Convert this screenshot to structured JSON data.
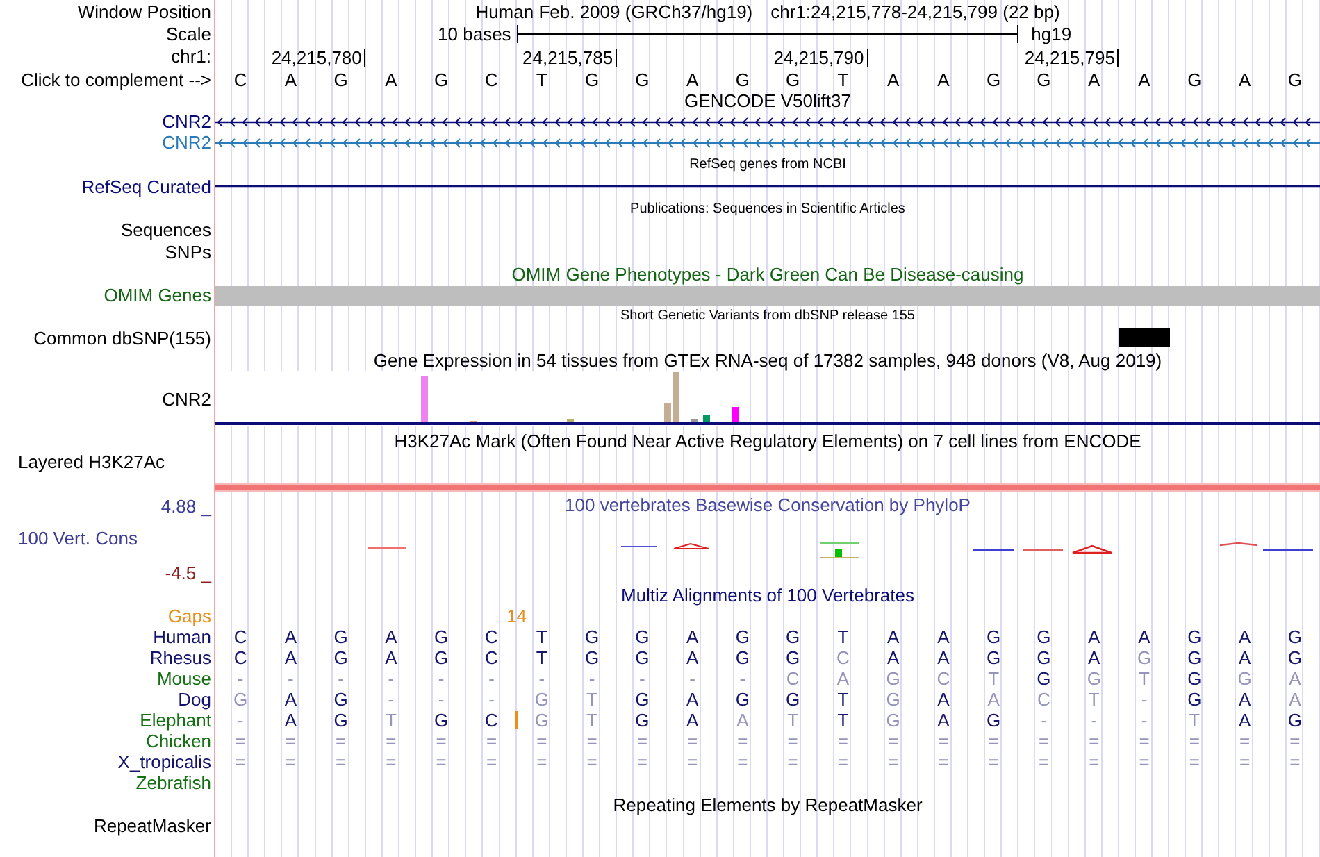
{
  "position": {
    "label": "Window Position",
    "assembly": "Human Feb. 2009 (GRCh37/hg19)",
    "range": "chr1:24,215,778-24,215,799 (22 bp)"
  },
  "scale": {
    "label": "Scale",
    "span": "10 bases",
    "assembly": "hg19"
  },
  "ruler": {
    "label": "chr1:",
    "ticks": [
      "24,215,780",
      "24,215,785",
      "24,215,790",
      "24,215,795"
    ]
  },
  "sequence": {
    "label": "Click to complement -->",
    "bases": [
      "C",
      "A",
      "G",
      "A",
      "G",
      "C",
      "T",
      "G",
      "G",
      "A",
      "G",
      "G",
      "T",
      "A",
      "A",
      "G",
      "G",
      "A",
      "A",
      "G",
      "A",
      "G"
    ]
  },
  "tracks": [
    {
      "kind": "gene_models",
      "title": {
        "text": "GENCODE V50lift37",
        "color": "#000000"
      },
      "rows": [
        {
          "label": "CNR2",
          "color": "#0c0c78"
        },
        {
          "label": "CNR2",
          "color": "#2b7bba"
        }
      ]
    },
    {
      "kind": "gene_line",
      "title": {
        "text": "RefSeq genes from NCBI",
        "color": "#000000"
      },
      "rows": [
        {
          "label": "RefSeq Curated",
          "color": "#0c0c78"
        }
      ]
    },
    {
      "kind": "empty_rows",
      "title": {
        "text": "Publications: Sequences in Scientific Articles",
        "color": "#000000"
      },
      "rows": [
        {
          "label": "Sequences",
          "color": "#000000"
        },
        {
          "label": "SNPs",
          "color": "#000000"
        }
      ]
    },
    {
      "kind": "bar",
      "title": {
        "text": "OMIM Gene Phenotypes - Dark Green Can Be Disease-causing",
        "color": "#146414"
      },
      "rows": [
        {
          "label": "OMIM Genes",
          "color": "#146414"
        }
      ]
    },
    {
      "kind": "variants",
      "title": {
        "text": "Short Genetic Variants from dbSNP release 155",
        "color": "#000000"
      },
      "rows": [
        {
          "label": "Common dbSNP(155)",
          "color": "#000000"
        }
      ]
    },
    {
      "kind": "expression",
      "title": {
        "text": "Gene Expression in 54 tissues from GTEx RNA-seq of 17382 samples, 948 donors (V8, Aug 2019)",
        "color": "#000000"
      },
      "rows": [
        {
          "label": "CNR2",
          "color": "#000000"
        }
      ]
    },
    {
      "kind": "signal",
      "title": {
        "text": "H3K27Ac Mark (Often Found Near Active Regulatory Elements) on 7 cell lines from ENCODE",
        "color": "#000000"
      },
      "rows": [
        {
          "label": "Layered H3K27Ac",
          "color": "#000000"
        }
      ]
    },
    {
      "kind": "conservation",
      "title": {
        "text": "100 vertebrates Basewise Conservation by PhyloP",
        "color": "#46469c"
      },
      "axis": {
        "max": {
          "text": "4.88 _",
          "color": "#3c3c96"
        },
        "min": {
          "text": "-4.5 _",
          "color": "#8b1e1e"
        }
      },
      "rows": [
        {
          "label": "100 Vert. Cons",
          "color": "#3c3c96"
        }
      ]
    },
    {
      "kind": "alignment",
      "title": {
        "text": "Multiz Alignments of 100 Vertebrates",
        "color": "#0c0c78"
      },
      "gaps": {
        "label": "Gaps",
        "color": "#e8901e"
      },
      "species": [
        {
          "name": "Human",
          "color": "#14146e",
          "bases": [
            {
              "base": "C",
              "match": true
            },
            {
              "base": "A",
              "match": true
            },
            {
              "base": "G",
              "match": true
            },
            {
              "base": "A",
              "match": true
            },
            {
              "base": "G",
              "match": true
            },
            {
              "base": "C",
              "match": true
            },
            {
              "base": "T",
              "match": true
            },
            {
              "base": "G",
              "match": true
            },
            {
              "base": "G",
              "match": true
            },
            {
              "base": "A",
              "match": true
            },
            {
              "base": "G",
              "match": true
            },
            {
              "base": "G",
              "match": true
            },
            {
              "base": "T",
              "match": true
            },
            {
              "base": "A",
              "match": true
            },
            {
              "base": "A",
              "match": true
            },
            {
              "base": "G",
              "match": true
            },
            {
              "base": "G",
              "match": true
            },
            {
              "base": "A",
              "match": true
            },
            {
              "base": "A",
              "match": true
            },
            {
              "base": "G",
              "match": true
            },
            {
              "base": "A",
              "match": true
            },
            {
              "base": "G",
              "match": true
            }
          ]
        },
        {
          "name": "Rhesus",
          "color": "#14146e",
          "bases": [
            {
              "base": "C",
              "match": true
            },
            {
              "base": "A",
              "match": true
            },
            {
              "base": "G",
              "match": true
            },
            {
              "base": "A",
              "match": true
            },
            {
              "base": "G",
              "match": true
            },
            {
              "base": "C",
              "match": true
            },
            {
              "base": "T",
              "match": true
            },
            {
              "base": "G",
              "match": true
            },
            {
              "base": "G",
              "match": true
            },
            {
              "base": "A",
              "match": true
            },
            {
              "base": "G",
              "match": true
            },
            {
              "base": "G",
              "match": true
            },
            {
              "base": "C",
              "match": false
            },
            {
              "base": "A",
              "match": true
            },
            {
              "base": "A",
              "match": true
            },
            {
              "base": "G",
              "match": true
            },
            {
              "base": "G",
              "match": true
            },
            {
              "base": "A",
              "match": true
            },
            {
              "base": "G",
              "match": false
            },
            {
              "base": "G",
              "match": true
            },
            {
              "base": "A",
              "match": true
            },
            {
              "base": "G",
              "match": true
            }
          ]
        },
        {
          "name": "Mouse",
          "color": "#137013",
          "bases": [
            {
              "base": "-",
              "match": false
            },
            {
              "base": "-",
              "match": false
            },
            {
              "base": "-",
              "match": false
            },
            {
              "base": "-",
              "match": false
            },
            {
              "base": "-",
              "match": false
            },
            {
              "base": "-",
              "match": false
            },
            {
              "base": "-",
              "match": false
            },
            {
              "base": "-",
              "match": false
            },
            {
              "base": "-",
              "match": false
            },
            {
              "base": "-",
              "match": false
            },
            {
              "base": "-",
              "match": false
            },
            {
              "base": "C",
              "match": false
            },
            {
              "base": "A",
              "match": false
            },
            {
              "base": "G",
              "match": false
            },
            {
              "base": "C",
              "match": false
            },
            {
              "base": "T",
              "match": false
            },
            {
              "base": "G",
              "match": true
            },
            {
              "base": "G",
              "match": false
            },
            {
              "base": "T",
              "match": false
            },
            {
              "base": "G",
              "match": true
            },
            {
              "base": "G",
              "match": false
            },
            {
              "base": "A",
              "match": false
            }
          ]
        },
        {
          "name": "Dog",
          "color": "#14146e",
          "bases": [
            {
              "base": "G",
              "match": false
            },
            {
              "base": "A",
              "match": true
            },
            {
              "base": "G",
              "match": true
            },
            {
              "base": "-",
              "match": false
            },
            {
              "base": "-",
              "match": false
            },
            {
              "base": "-",
              "match": false
            },
            {
              "base": "G",
              "match": false
            },
            {
              "base": "T",
              "match": false
            },
            {
              "base": "G",
              "match": true
            },
            {
              "base": "A",
              "match": true
            },
            {
              "base": "G",
              "match": true
            },
            {
              "base": "G",
              "match": true
            },
            {
              "base": "T",
              "match": true
            },
            {
              "base": "G",
              "match": false
            },
            {
              "base": "A",
              "match": true
            },
            {
              "base": "A",
              "match": false
            },
            {
              "base": "C",
              "match": false
            },
            {
              "base": "T",
              "match": false
            },
            {
              "base": "-",
              "match": false
            },
            {
              "base": "G",
              "match": true
            },
            {
              "base": "A",
              "match": true
            },
            {
              "base": "A",
              "match": false
            }
          ]
        },
        {
          "name": "Elephant",
          "color": "#137013",
          "bases": [
            {
              "base": "-",
              "match": false
            },
            {
              "base": "A",
              "match": true
            },
            {
              "base": "G",
              "match": true
            },
            {
              "base": "T",
              "match": false
            },
            {
              "base": "G",
              "match": true
            },
            {
              "base": "C",
              "match": true
            },
            {
              "base": "G",
              "match": false,
              "gap_before": "14"
            },
            {
              "base": "T",
              "match": false
            },
            {
              "base": "G",
              "match": true
            },
            {
              "base": "A",
              "match": true
            },
            {
              "base": "A",
              "match": false
            },
            {
              "base": "T",
              "match": false
            },
            {
              "base": "T",
              "match": true
            },
            {
              "base": "G",
              "match": false
            },
            {
              "base": "A",
              "match": true
            },
            {
              "base": "G",
              "match": true
            },
            {
              "base": "-",
              "match": false
            },
            {
              "base": "-",
              "match": false
            },
            {
              "base": "-",
              "match": false
            },
            {
              "base": "T",
              "match": false
            },
            {
              "base": "A",
              "match": true
            },
            {
              "base": "G",
              "match": true
            }
          ]
        },
        {
          "name": "Chicken",
          "color": "#137013",
          "bases": [
            {
              "base": "=",
              "match": false
            },
            {
              "base": "=",
              "match": false
            },
            {
              "base": "=",
              "match": false
            },
            {
              "base": "=",
              "match": false
            },
            {
              "base": "=",
              "match": false
            },
            {
              "base": "=",
              "match": false
            },
            {
              "base": "=",
              "match": false
            },
            {
              "base": "=",
              "match": false
            },
            {
              "base": "=",
              "match": false
            },
            {
              "base": "=",
              "match": false
            },
            {
              "base": "=",
              "match": false
            },
            {
              "base": "=",
              "match": false
            },
            {
              "base": "=",
              "match": false
            },
            {
              "base": "=",
              "match": false
            },
            {
              "base": "=",
              "match": false
            },
            {
              "base": "=",
              "match": false
            },
            {
              "base": "=",
              "match": false
            },
            {
              "base": "=",
              "match": false
            },
            {
              "base": "=",
              "match": false
            },
            {
              "base": "=",
              "match": false
            },
            {
              "base": "=",
              "match": false
            },
            {
              "base": "=",
              "match": false
            }
          ]
        },
        {
          "name": "X_tropicalis",
          "color": "#14146e",
          "bases": [
            {
              "base": "=",
              "match": false
            },
            {
              "base": "=",
              "match": false
            },
            {
              "base": "=",
              "match": false
            },
            {
              "base": "=",
              "match": false
            },
            {
              "base": "=",
              "match": false
            },
            {
              "base": "=",
              "match": false
            },
            {
              "base": "=",
              "match": false
            },
            {
              "base": "=",
              "match": false
            },
            {
              "base": "=",
              "match": false
            },
            {
              "base": "=",
              "match": false
            },
            {
              "base": "=",
              "match": false
            },
            {
              "base": "=",
              "match": false
            },
            {
              "base": "=",
              "match": false
            },
            {
              "base": "=",
              "match": false
            },
            {
              "base": "=",
              "match": false
            },
            {
              "base": "=",
              "match": false
            },
            {
              "base": "=",
              "match": false
            },
            {
              "base": "=",
              "match": false
            },
            {
              "base": "=",
              "match": false
            },
            {
              "base": "=",
              "match": false
            },
            {
              "base": "=",
              "match": false
            },
            {
              "base": "=",
              "match": false
            }
          ]
        },
        {
          "name": "Zebrafish",
          "color": "#137013"
        }
      ]
    },
    {
      "kind": "repeats",
      "title": {
        "text": "Repeating Elements by RepeatMasker",
        "color": "#000000"
      },
      "rows": [
        {
          "label": "RepeatMasker",
          "color": "#000000"
        }
      ]
    }
  ]
}
